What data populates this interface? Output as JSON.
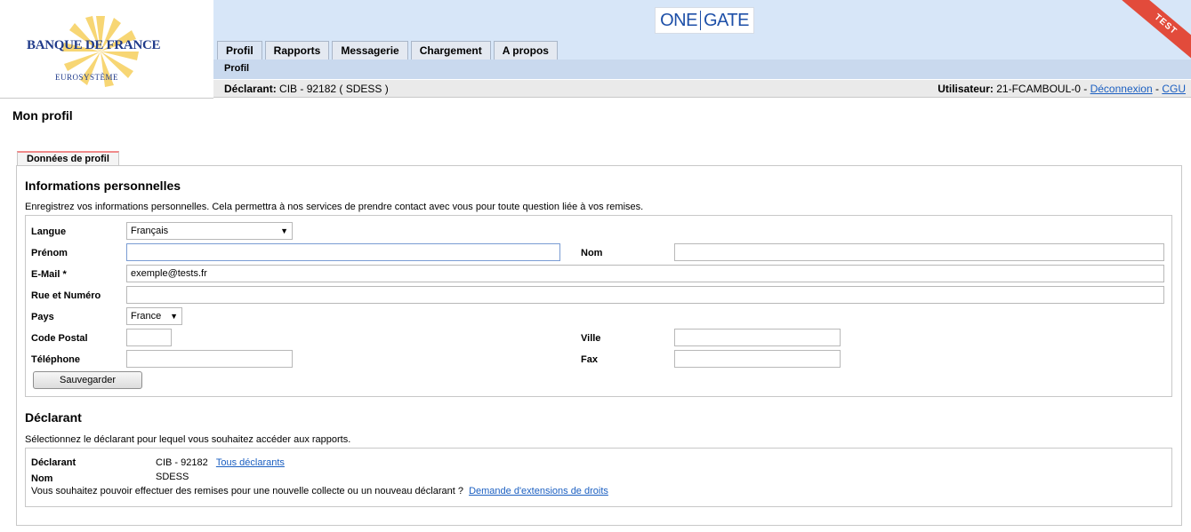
{
  "brand": {
    "name": "BANQUE DE FRANCE",
    "sub": "EUROSYSTÈME",
    "app_left": "ONE",
    "app_right": "GATE",
    "env_badge": "TEST"
  },
  "nav": {
    "tabs": [
      {
        "label": "Profil",
        "active": true
      },
      {
        "label": "Rapports",
        "active": false
      },
      {
        "label": "Messagerie",
        "active": false
      },
      {
        "label": "Chargement",
        "active": false
      },
      {
        "label": "A propos",
        "active": false
      }
    ],
    "sub_item": "Profil"
  },
  "context": {
    "declarant_label": "Déclarant:",
    "declarant_value": "CIB - 92182 ( SDESS )",
    "user_label": "Utilisateur:",
    "user_value": "21-FCAMBOUL-0",
    "sep1": " - ",
    "logout": "Déconnexion",
    "sep2": " - ",
    "cgu": "CGU"
  },
  "page": {
    "title": "Mon profil",
    "tab": "Données de profil"
  },
  "personal": {
    "title": "Informations personnelles",
    "description": "Enregistrez vos informations personnelles. Cela permettra à nos services de prendre contact avec vous pour toute question liée à vos remises.",
    "fields": {
      "langue_label": "Langue",
      "langue_value": "Français",
      "prenom_label": "Prénom",
      "prenom_value": "",
      "nom_label": "Nom",
      "nom_value": "",
      "email_label": "E-Mail *",
      "email_value": "exemple@tests.fr",
      "rue_label": "Rue et Numéro",
      "rue_value": "",
      "pays_label": "Pays",
      "pays_value": "France",
      "cp_label": "Code Postal",
      "cp_value": "",
      "ville_label": "Ville",
      "ville_value": "",
      "tel_label": "Téléphone",
      "tel_value": "",
      "fax_label": "Fax",
      "fax_value": ""
    },
    "save_label": "Sauvegarder"
  },
  "declarant": {
    "title": "Déclarant",
    "description": "Sélectionnez le déclarant pour lequel vous souhaitez accéder aux rapports.",
    "declarant_label": "Déclarant",
    "declarant_value": "CIB - 92182",
    "all_link": "Tous déclarants",
    "nom_label": "Nom",
    "nom_value": "SDESS",
    "question": "Vous souhaitez pouvoir effectuer des remises pour une nouvelle collecte ou un nouveau déclarant ?",
    "extension_link": "Demande d'extensions de droits"
  },
  "colors": {
    "brand_blue": "#1f3a8a",
    "header_band": "#d7e6f8",
    "link": "#1b5fc1",
    "test_badge": "#e24b3b",
    "tab_accent": "#f08a8a"
  },
  "icons": {
    "dropdown": "chevron-down-icon",
    "logo": "sun-rays-logo-icon"
  }
}
